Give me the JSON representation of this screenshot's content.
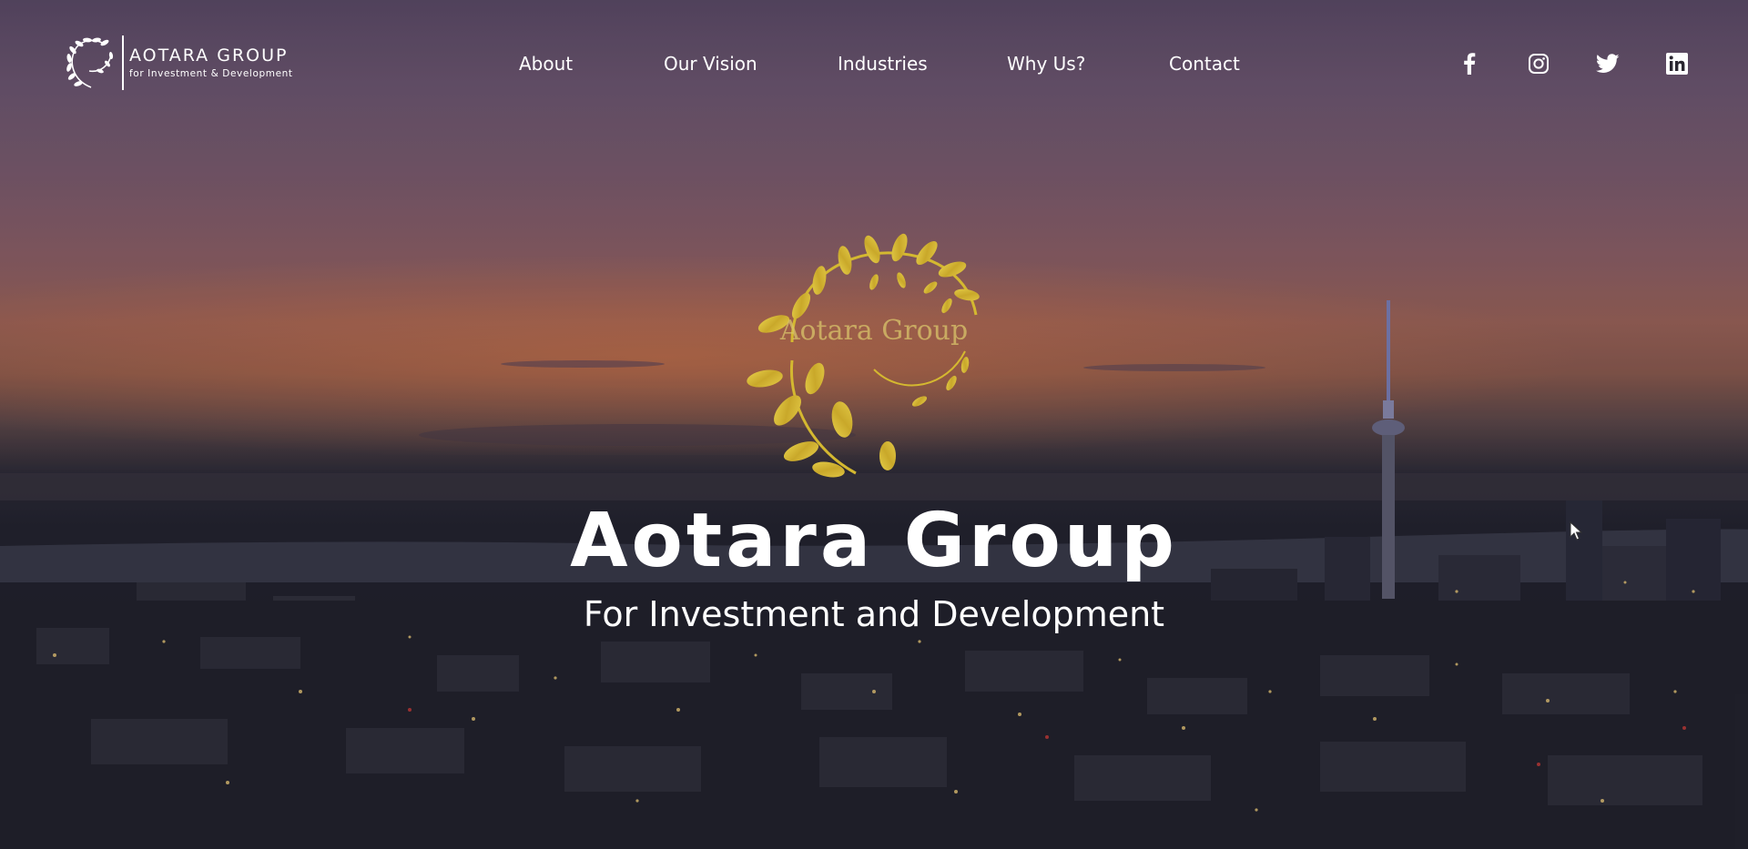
{
  "brand": {
    "name": "AOTARA GROUP",
    "tagline": "for Investment & Development"
  },
  "nav": {
    "items": [
      {
        "label": "About"
      },
      {
        "label": "Our Vision"
      },
      {
        "label": "Industries"
      },
      {
        "label": "Why Us?"
      },
      {
        "label": "Contact"
      }
    ]
  },
  "social": {
    "icons": [
      "facebook-icon",
      "instagram-icon",
      "twitter-icon",
      "linkedin-icon"
    ]
  },
  "hero": {
    "logo_text": "Aotara Group",
    "title": "Aotara Group",
    "subtitle": "For Investment and Development"
  },
  "colors": {
    "text": "#ffffff",
    "logo_gold": "#d4b830",
    "sky_top": "#5b4a66",
    "sunset": "#9a6258",
    "city_dark": "#1f1f28"
  }
}
